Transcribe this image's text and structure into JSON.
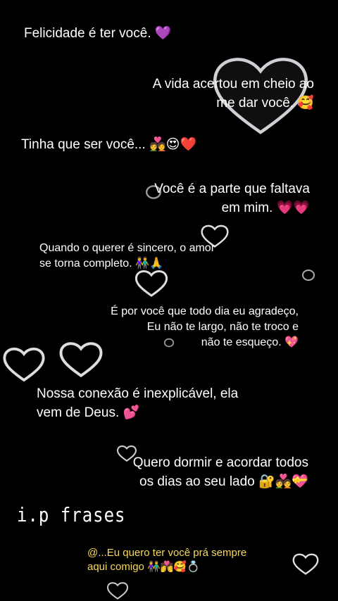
{
  "quotes": [
    "Felicidade é ter você. 💜",
    "A vida acertou em cheio ao\nme dar você. 🥰",
    "Tinha que ser você... 💑😍❤️",
    "Você é a parte que faltava\nem mim. 💗💗",
    "Quando o querer é sincero, o amor\nse torna completo. 👫🙏",
    "É por você que todo dia eu agradeço,\nEu não te largo, não te troco e\nnão te esqueço. 💖",
    "Nossa conexão é inexplicável, ela\nvem de Deus. 💕",
    "Quero dormir e acordar todos\nos dias ao seu lado 🔐💑💝"
  ],
  "brand": "i.p frases",
  "footer": "@...Eu quero ter você prá sempre\naqui comigo 👫💏🥰💍"
}
